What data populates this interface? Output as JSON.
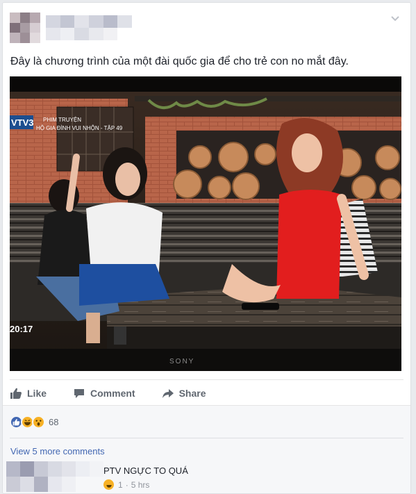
{
  "post": {
    "text": "Đây là chương trình của một đài quốc gia để cho trẻ con no mắt đây."
  },
  "media": {
    "channel_logo": "VTV3",
    "program_line1": "PHIM TRUYỆN",
    "program_line2": "HỘ GIA ĐÌNH VUI NHỘN - TẬP 49",
    "clock": "20:17",
    "tv_brand": "SONY"
  },
  "actions": {
    "like": "Like",
    "comment": "Comment",
    "share": "Share",
    "like_icon": "thumbs-up-icon",
    "comment_icon": "speech-bubble-icon",
    "share_icon": "share-arrow-icon"
  },
  "reactions": {
    "count": "68",
    "types": [
      "like",
      "haha",
      "wow"
    ],
    "colors": {
      "like": "#4267b2",
      "emoji": "#f7b125"
    }
  },
  "comments": {
    "view_more": "View 5 more comments",
    "items": [
      {
        "text": "PTV NGỰC TO QUÁ",
        "reaction_count": "1",
        "time": "5 hrs",
        "reaction_type": "haha"
      }
    ]
  },
  "colors": {
    "link": "#4267b2",
    "text": "#1d2129",
    "muted": "#606770",
    "background": "#e9ebee"
  }
}
